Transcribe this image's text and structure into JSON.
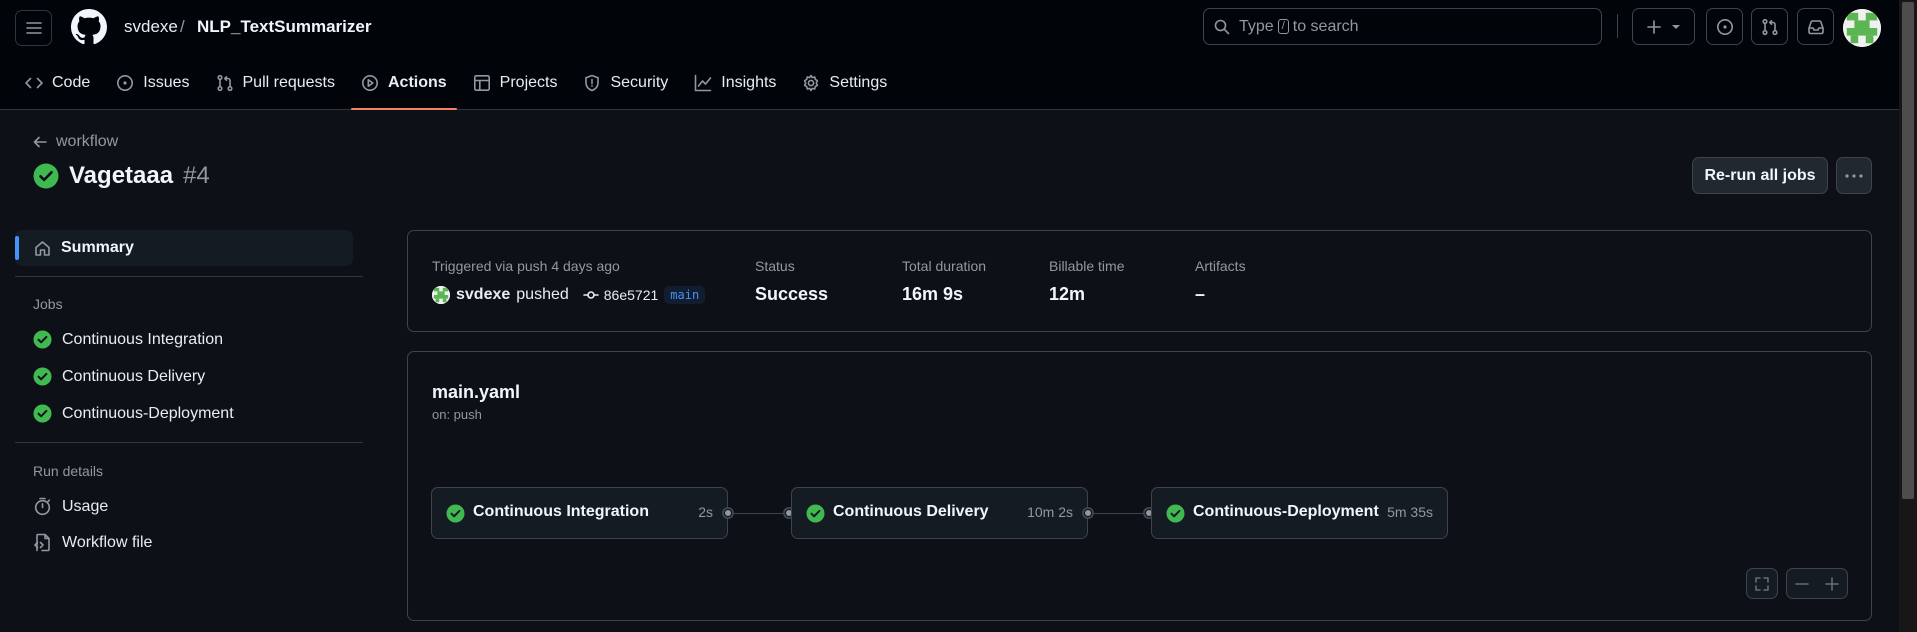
{
  "header": {
    "owner": "svdexe",
    "separator": "/",
    "repo": "NLP_TextSummarizer",
    "search_prefix": "Type",
    "search_key": "/",
    "search_suffix": "to search"
  },
  "tabs": [
    {
      "label": "Code",
      "icon": "code-icon"
    },
    {
      "label": "Issues",
      "icon": "issue-icon"
    },
    {
      "label": "Pull requests",
      "icon": "pull-request-icon"
    },
    {
      "label": "Actions",
      "icon": "play-icon",
      "active": true
    },
    {
      "label": "Projects",
      "icon": "table-icon"
    },
    {
      "label": "Security",
      "icon": "shield-icon"
    },
    {
      "label": "Insights",
      "icon": "graph-icon"
    },
    {
      "label": "Settings",
      "icon": "gear-icon"
    }
  ],
  "run": {
    "back_label": "workflow",
    "title": "Vagetaaa",
    "number": "#4",
    "rerun_label": "Re-run all jobs"
  },
  "sidebar": {
    "summary_label": "Summary",
    "jobs_heading": "Jobs",
    "jobs": [
      {
        "label": "Continuous Integration",
        "status": "success"
      },
      {
        "label": "Continuous Delivery",
        "status": "success"
      },
      {
        "label": "Continuous-Deployment",
        "status": "success"
      }
    ],
    "details_heading": "Run details",
    "details": [
      {
        "label": "Usage",
        "icon": "stopwatch-icon"
      },
      {
        "label": "Workflow file",
        "icon": "file-code-icon"
      }
    ]
  },
  "summary": {
    "trigger_label": "Triggered via push 4 days ago",
    "actor": "svdexe",
    "action": "pushed",
    "commit": "86e5721",
    "branch": "main",
    "status_label": "Status",
    "status_value": "Success",
    "duration_label": "Total duration",
    "duration_value": "16m 9s",
    "billable_label": "Billable time",
    "billable_value": "12m",
    "artifacts_label": "Artifacts",
    "artifacts_value": "–"
  },
  "graph": {
    "workflow_file": "main.yaml",
    "trigger": "on: push",
    "jobs": [
      {
        "name": "Continuous Integration",
        "duration": "2s",
        "status": "success"
      },
      {
        "name": "Continuous Delivery",
        "duration": "10m 2s",
        "status": "success"
      },
      {
        "name": "Continuous-Deployment",
        "duration": "5m 35s",
        "status": "success"
      }
    ]
  },
  "colors": {
    "success": "#3fb950",
    "accent_tab": "#f78166",
    "selected_bar": "#4493f8"
  }
}
